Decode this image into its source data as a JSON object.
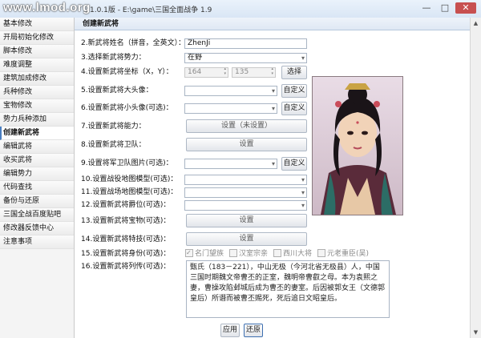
{
  "window": {
    "watermark": "www.lmod.org",
    "title": "1.0.1版 - E:\\game\\三国全面战争 1.9",
    "min_label": "—",
    "max_label": "□",
    "close_label": "✕"
  },
  "sidebar": {
    "items": [
      {
        "label": "基本修改"
      },
      {
        "label": "开局初始化修改"
      },
      {
        "label": "脚本修改"
      },
      {
        "label": "难度调整"
      },
      {
        "label": "建筑加成修改"
      },
      {
        "label": "兵种修改"
      },
      {
        "label": "宝物修改"
      },
      {
        "label": "势力兵种添加"
      },
      {
        "label": "创建新武将",
        "active": true
      },
      {
        "label": "编辑武将"
      },
      {
        "label": "收买武将"
      },
      {
        "label": "编辑势力"
      },
      {
        "label": "代码查找"
      },
      {
        "label": "备份与还原"
      },
      {
        "label": "三国全战百度贴吧"
      },
      {
        "label": "修改器反馈中心"
      },
      {
        "label": "注意事项"
      }
    ]
  },
  "panel": {
    "title": "创建新武将",
    "rows": {
      "name": {
        "label": "2.新武将姓名（拼音，全英文）：",
        "value": "ZhenJi"
      },
      "faction": {
        "label": "3.选择新武将势力：",
        "value": "在野"
      },
      "coord": {
        "label": "4.设置新武将坐标（X，Y）：",
        "x": "164",
        "y": "135",
        "button": "选择"
      },
      "big_portrait": {
        "label": "5.设置新武将大头像：",
        "button": "自定义"
      },
      "small_portrait": {
        "label": "6.设置新武将小头像(可选)：",
        "button": "自定义"
      },
      "ability": {
        "label": "7.设置新武将能力：",
        "button": "设置（未设置）"
      },
      "guard": {
        "label": "8.设置新武将卫队：",
        "button": "设置"
      },
      "guard_card": {
        "label": "9.设置将军卫队图片(可选)：",
        "button": "自定义"
      },
      "battle_model": {
        "label": "10.设置战役地图模型(可选)："
      },
      "field_model": {
        "label": "11.设置战场地图模型(可选)："
      },
      "rank": {
        "label": "12.设置新武将爵位(可选)："
      },
      "treasure": {
        "label": "13.设置新武将宝物(可选)：",
        "button": "设置"
      },
      "traits": {
        "label": "14.设置新武将特技(可选)：",
        "button": "设置"
      },
      "identity": {
        "label": "15.设置新武将身份(可选)：",
        "options": [
          {
            "label": "名门望族",
            "checked": true
          },
          {
            "label": "汉室宗亲",
            "checked": false
          },
          {
            "label": "西川大将",
            "checked": false
          },
          {
            "label": "元老重臣(吴)",
            "checked": false
          }
        ]
      },
      "bio": {
        "label": "16.设置新武将列传(可选)：",
        "text": "甄氏（183－221），中山无极（今河北省无极县）人，中国三国时期魏文帝曹丕的正室，魏明帝曹叡之母。本为袁熙之妻，曹操攻陷邺城后成为曹丕的妻室。后因被郭女王（文德郭皇后）所谮而被曹丕赐死，死后追日文昭皇后。"
      }
    },
    "apply_label": "应用",
    "reset_label": "还原"
  },
  "colors": {
    "accent": "#4a7fc1",
    "panel_header": "#dfe8f4",
    "sidebar_bg": "#f4f4f4"
  }
}
